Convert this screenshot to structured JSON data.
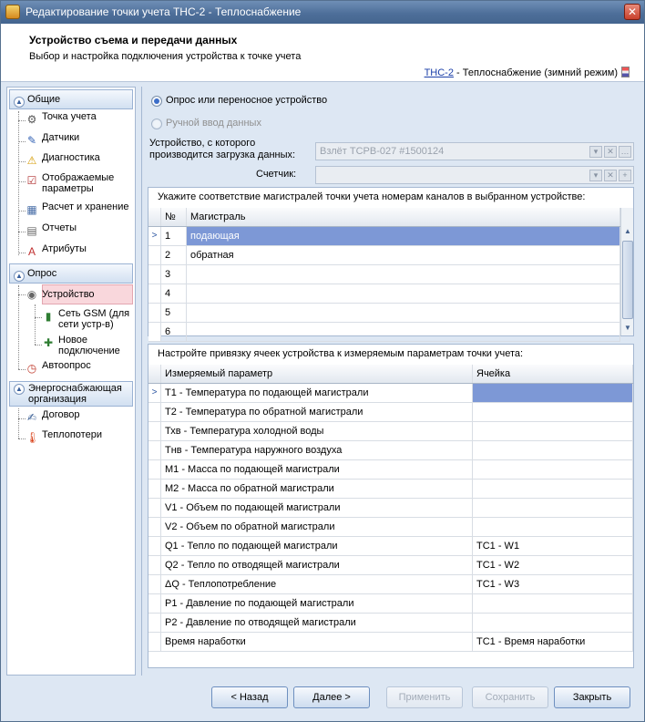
{
  "window": {
    "title": "Редактирование точки учета ТНС-2 - Теплоснабжение"
  },
  "header": {
    "title": "Устройство съема и передачи данных",
    "subtitle": "Выбор и настройка подключения устройства к точке учета",
    "link_text": "ТНС-2",
    "link_suffix": " - Теплоснабжение (зимний режим)"
  },
  "nav": {
    "groups": [
      {
        "label": "Общие"
      },
      {
        "label": "Опрос"
      },
      {
        "label": "Энергоснабжающая организация"
      }
    ],
    "general_items": [
      {
        "label": "Точка учета",
        "icon": "meter-icon"
      },
      {
        "label": "Датчики",
        "icon": "pencil-icon"
      },
      {
        "label": "Диагностика",
        "icon": "warning-icon"
      },
      {
        "label": "Отображаемые параметры",
        "icon": "checklist-icon"
      },
      {
        "label": "Расчет и хранение",
        "icon": "calculator-icon"
      },
      {
        "label": "Отчеты",
        "icon": "document-icon"
      },
      {
        "label": "Атрибуты",
        "icon": "attributes-icon"
      }
    ],
    "poll_items": [
      {
        "label": "Устройство",
        "icon": "device-icon"
      },
      {
        "label": "Сеть GSM (для сети устр-в)",
        "icon": "phone-icon"
      },
      {
        "label": "Новое подключение",
        "icon": "new-connection-icon"
      },
      {
        "label": "Автоопрос",
        "icon": "clock-icon"
      }
    ],
    "org_items": [
      {
        "label": "Договор",
        "icon": "contract-icon"
      },
      {
        "label": "Теплопотери",
        "icon": "thermometer-icon"
      }
    ]
  },
  "main": {
    "radio_poll": "Опрос или переносное устройство",
    "radio_manual": "Ручной ввод данных",
    "device_label": "Устройство, с которого производится загрузка данных:",
    "device_value": "Взлёт ТСРВ-027 #1500124",
    "counter_label": "Счетчик:",
    "counter_value": ""
  },
  "mains_grid": {
    "caption": "Укажите соответствие магистралей точки учета номерам каналов в выбранном устройстве:",
    "columns": [
      "№",
      "Магистраль"
    ],
    "rows": [
      {
        "num": "1",
        "name": "подающая"
      },
      {
        "num": "2",
        "name": "обратная"
      },
      {
        "num": "3",
        "name": ""
      },
      {
        "num": "4",
        "name": ""
      },
      {
        "num": "5",
        "name": ""
      },
      {
        "num": "6",
        "name": ""
      }
    ]
  },
  "params_grid": {
    "caption": "Настройте привязку ячеек устройства к измеряемым параметрам точки учета:",
    "columns": [
      "Измеряемый параметр",
      "Ячейка"
    ],
    "rows": [
      {
        "param": "T1 - Температура по подающей магистрали",
        "cell": ""
      },
      {
        "param": "T2 - Температура по обратной магистрали",
        "cell": ""
      },
      {
        "param": "Тхв - Температура холодной воды",
        "cell": ""
      },
      {
        "param": "Тнв - Температура наружного воздуха",
        "cell": ""
      },
      {
        "param": "M1 - Масса по подающей магистрали",
        "cell": ""
      },
      {
        "param": "M2 - Масса по обратной магистрали",
        "cell": ""
      },
      {
        "param": "V1 - Объем по подающей магистрали",
        "cell": ""
      },
      {
        "param": "V2 - Объем по обратной магистрали",
        "cell": ""
      },
      {
        "param": "Q1 - Тепло по подающей магистрали",
        "cell": "TC1 - W1"
      },
      {
        "param": "Q2 - Тепло по отводящей магистрали",
        "cell": "TC1 - W2"
      },
      {
        "param": "ΔQ - Теплопотребление",
        "cell": "TC1 - W3"
      },
      {
        "param": "P1 - Давление по подающей магистрали",
        "cell": ""
      },
      {
        "param": "P2 - Давление по отводящей магистрали",
        "cell": ""
      },
      {
        "param": "Время наработки",
        "cell": "TC1 - Время наработки"
      }
    ]
  },
  "footer": {
    "back": "< Назад",
    "next": "Далее >",
    "apply": "Применить",
    "save": "Сохранить",
    "close": "Закрыть"
  }
}
